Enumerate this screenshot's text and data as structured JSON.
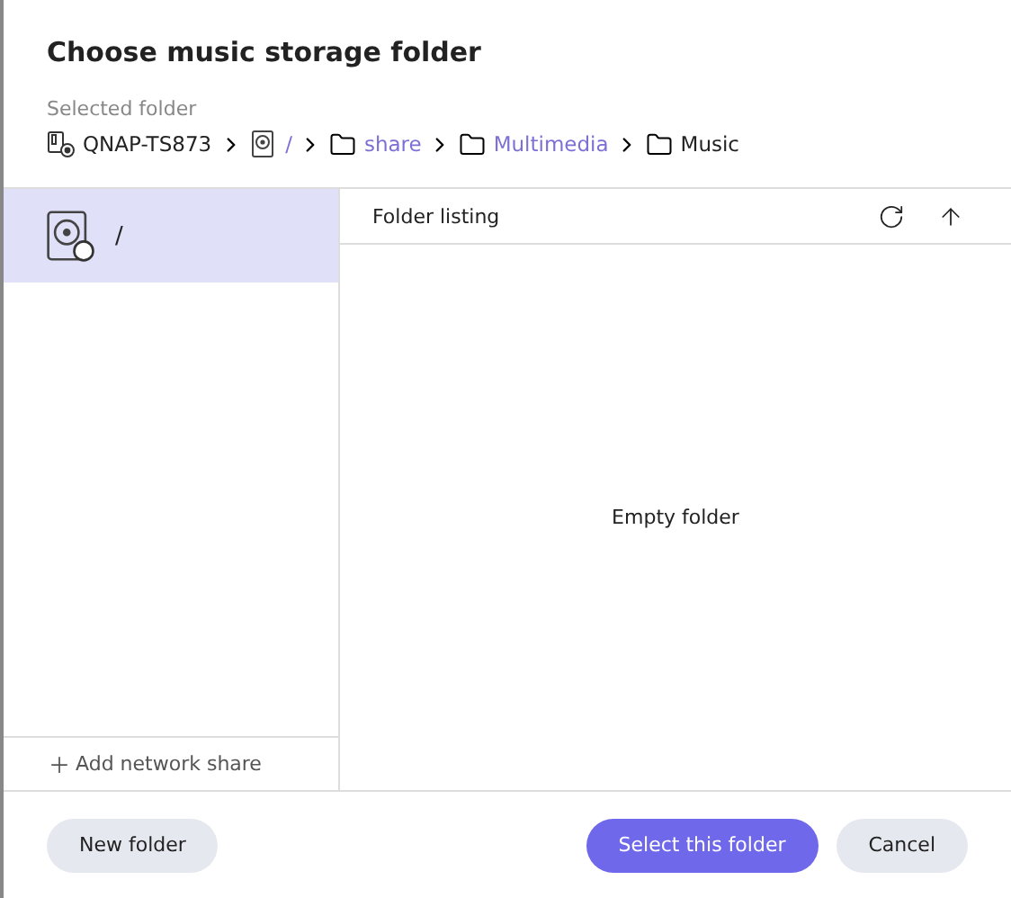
{
  "dialog": {
    "title": "Choose music storage folder"
  },
  "selected_folder": {
    "label": "Selected folder",
    "path": [
      {
        "kind": "device",
        "text": "QNAP-TS873",
        "link": false
      },
      {
        "kind": "drive",
        "text": "/",
        "link": true
      },
      {
        "kind": "folder",
        "text": "share",
        "link": true
      },
      {
        "kind": "folder",
        "text": "Multimedia",
        "link": true
      },
      {
        "kind": "folder",
        "text": "Music",
        "link": false
      }
    ]
  },
  "sidebar": {
    "items": [
      {
        "kind": "drive",
        "text": "/",
        "selected": true
      }
    ],
    "add_button": "Add network share"
  },
  "listing": {
    "header": "Folder listing",
    "empty_text": "Empty folder"
  },
  "buttons": [
    {
      "kind": "secondary",
      "text": "New folder"
    },
    {
      "kind": "primary",
      "text": "Select this folder"
    },
    {
      "kind": "secondary",
      "text": "Cancel"
    }
  ]
}
